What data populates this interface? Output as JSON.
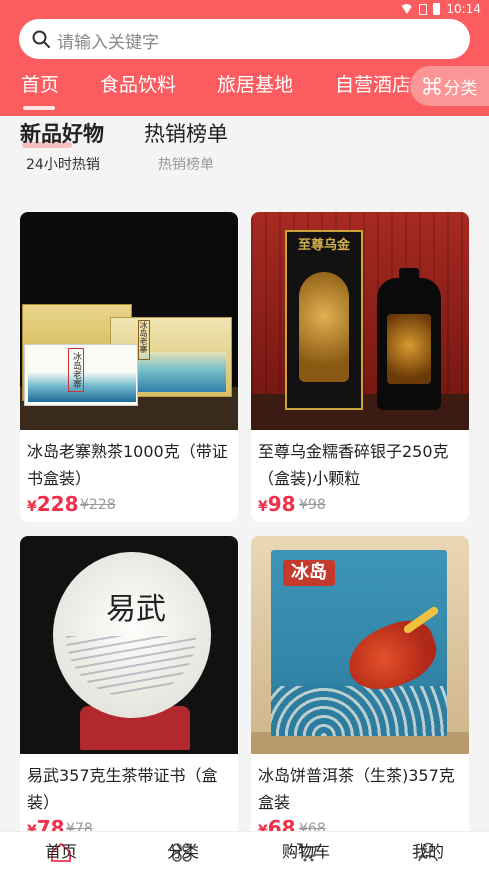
{
  "status": {
    "time": "10:14"
  },
  "search": {
    "placeholder": "请输入关键字"
  },
  "nav": {
    "items": [
      "首页",
      "食品饮料",
      "旅居基地",
      "自营酒店"
    ],
    "category_label": "分类"
  },
  "tabs": [
    {
      "title": "新品好物",
      "subtitle": "24小时热销"
    },
    {
      "title": "热销榜单",
      "subtitle": "热销榜单"
    }
  ],
  "products": [
    {
      "name": "冰岛老寨熟茶1000克（带证书盒装）",
      "price": "228",
      "original": "¥228"
    },
    {
      "name": "至尊乌金糯香碎银子250克（盒装)小颗粒",
      "price": "98",
      "original": "¥98"
    },
    {
      "name": "易武357克生茶带证书（盒装）",
      "price": "78",
      "original": "¥78"
    },
    {
      "name": "冰岛饼普洱茶（生茶)357克盒装",
      "price": "68",
      "original": "¥68"
    }
  ],
  "currency": "¥",
  "image_text": {
    "p1": "冰岛老寨",
    "p2": "至尊乌金",
    "p3": "易武",
    "p4": "冰岛"
  },
  "bottom_nav": [
    "首页",
    "分类",
    "购物车",
    "我的"
  ],
  "colors": {
    "brand": "#fa5c5f",
    "price": "#f0304a"
  }
}
